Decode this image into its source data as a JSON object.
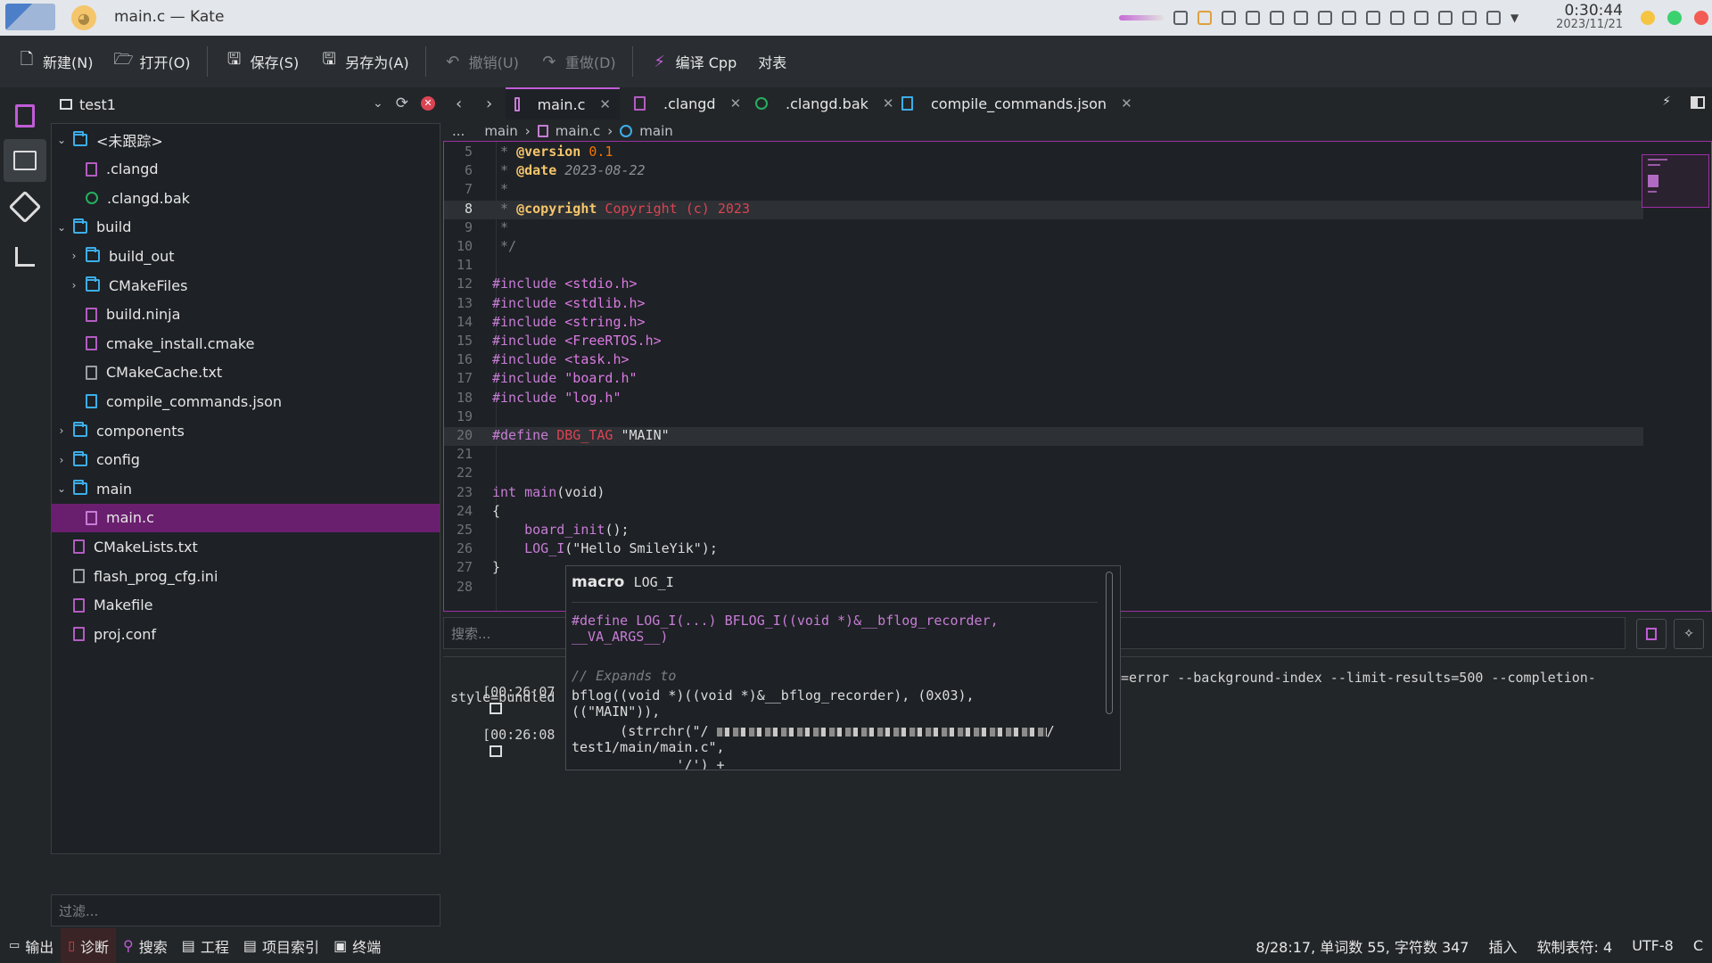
{
  "window": {
    "title": "main.c — Kate"
  },
  "clock": {
    "time": "0:30:44",
    "date": "2023/11/21"
  },
  "colors": {
    "accent": "#c05cd6",
    "selection": "#6a1f6e",
    "editor_bg": "#1e2125",
    "panel_bg": "#232629"
  },
  "toolbar": {
    "new": "新建(N)",
    "open": "打开(O)",
    "save": "保存(S)",
    "save_as": "另存为(A)",
    "undo": "撤销(U)",
    "redo": "重做(D)",
    "compile": "编译 Cpp",
    "pair": "对表"
  },
  "project": {
    "name": "test1",
    "filter_placeholder": "过滤..."
  },
  "tree": [
    {
      "label": "<未跟踪>",
      "kind": "folder",
      "depth": 0,
      "expanded": true
    },
    {
      "label": ".clangd",
      "kind": "file",
      "depth": 1
    },
    {
      "label": ".clangd.bak",
      "kind": "recycle",
      "depth": 1
    },
    {
      "label": "build",
      "kind": "folder",
      "depth": 0,
      "expanded": true
    },
    {
      "label": "build_out",
      "kind": "folder",
      "depth": 1,
      "expanded": false
    },
    {
      "label": "CMakeFiles",
      "kind": "folder",
      "depth": 1,
      "expanded": false
    },
    {
      "label": "build.ninja",
      "kind": "file",
      "depth": 1
    },
    {
      "label": "cmake_install.cmake",
      "kind": "file",
      "depth": 1
    },
    {
      "label": "CMakeCache.txt",
      "kind": "plain",
      "depth": 1
    },
    {
      "label": "compile_commands.json",
      "kind": "json",
      "depth": 1
    },
    {
      "label": "components",
      "kind": "folder",
      "depth": 0,
      "expanded": false
    },
    {
      "label": "config",
      "kind": "folder",
      "depth": 0,
      "expanded": false
    },
    {
      "label": "main",
      "kind": "folder",
      "depth": 0,
      "expanded": true
    },
    {
      "label": "main.c",
      "kind": "c",
      "depth": 1,
      "selected": true
    },
    {
      "label": "CMakeLists.txt",
      "kind": "file",
      "depth": 0
    },
    {
      "label": "flash_prog_cfg.ini",
      "kind": "plain",
      "depth": 0
    },
    {
      "label": "Makefile",
      "kind": "file",
      "depth": 0
    },
    {
      "label": "proj.conf",
      "kind": "file",
      "depth": 0
    }
  ],
  "tabs": [
    {
      "label": "main.c",
      "active": true
    },
    {
      "label": ".clangd"
    },
    {
      "label": ".clangd.bak"
    },
    {
      "label": "compile_commands.json"
    }
  ],
  "breadcrumb": {
    "root": "...",
    "folder": "main",
    "file": "main.c",
    "symbol": "main"
  },
  "code": [
    {
      "n": "5",
      "segs": [
        [
          "c-comment",
          " * "
        ],
        [
          "c-tag",
          "@version"
        ],
        [
          "c-num",
          " 0.1"
        ]
      ]
    },
    {
      "n": "6",
      "segs": [
        [
          "c-comment",
          " * "
        ],
        [
          "c-tag",
          "@date"
        ],
        [
          "c-date",
          " 2023-08-22"
        ]
      ]
    },
    {
      "n": "7",
      "segs": [
        [
          "c-comment",
          " *"
        ]
      ]
    },
    {
      "n": "8",
      "segs": [
        [
          "c-comment",
          " * "
        ],
        [
          "c-tag",
          "@copyright"
        ],
        [
          "c-red",
          " Copyright (c) 2023"
        ]
      ],
      "current": true
    },
    {
      "n": "9",
      "segs": [
        [
          "c-comment",
          " *"
        ]
      ]
    },
    {
      "n": "10",
      "segs": [
        [
          "c-comment",
          " */"
        ]
      ]
    },
    {
      "n": "11",
      "segs": []
    },
    {
      "n": "12",
      "segs": [
        [
          "c-pre",
          "#include "
        ],
        [
          "c-inc",
          "<stdio.h>"
        ]
      ]
    },
    {
      "n": "13",
      "segs": [
        [
          "c-pre",
          "#include "
        ],
        [
          "c-inc",
          "<stdlib.h>"
        ]
      ]
    },
    {
      "n": "14",
      "segs": [
        [
          "c-pre",
          "#include "
        ],
        [
          "c-inc",
          "<string.h>"
        ]
      ]
    },
    {
      "n": "15",
      "segs": [
        [
          "c-pre",
          "#include "
        ],
        [
          "c-inc",
          "<FreeRTOS.h>"
        ]
      ]
    },
    {
      "n": "16",
      "segs": [
        [
          "c-pre",
          "#include "
        ],
        [
          "c-inc",
          "<task.h>"
        ]
      ]
    },
    {
      "n": "17",
      "segs": [
        [
          "c-pre",
          "#include "
        ],
        [
          "c-inc",
          "\"board.h\""
        ]
      ]
    },
    {
      "n": "18",
      "segs": [
        [
          "c-pre",
          "#include "
        ],
        [
          "c-inc",
          "\"log.h\""
        ]
      ]
    },
    {
      "n": "19",
      "segs": []
    },
    {
      "n": "20",
      "segs": [
        [
          "c-pre",
          "#define "
        ],
        [
          "c-red",
          "DBG_TAG"
        ],
        [
          "c-str",
          " \"MAIN\""
        ]
      ],
      "hl": true
    },
    {
      "n": "21",
      "segs": []
    },
    {
      "n": "22",
      "segs": []
    },
    {
      "n": "23",
      "segs": [
        [
          "c-kw",
          "int "
        ],
        [
          "c-call",
          "main"
        ],
        [
          "c-str",
          "(void)"
        ]
      ]
    },
    {
      "n": "24",
      "segs": [
        [
          "c-str",
          "{"
        ]
      ]
    },
    {
      "n": "25",
      "segs": [
        [
          "c-call",
          "    board_init"
        ],
        [
          "c-str",
          "();"
        ]
      ]
    },
    {
      "n": "26",
      "segs": [
        [
          "c-call",
          "    LOG_I"
        ],
        [
          "c-str",
          "(\"Hello SmileYik\");"
        ]
      ]
    },
    {
      "n": "27",
      "segs": [
        [
          "c-str",
          "}"
        ]
      ]
    },
    {
      "n": "28",
      "segs": []
    }
  ],
  "search": {
    "placeholder": "搜索..."
  },
  "output": {
    "line1_time": "[00:26:07",
    "line1_tail": "=error --background-index --limit-results=500 --completion-",
    "line2": "style=bundled",
    "line3_time": "[00:26:08"
  },
  "popup": {
    "kind": "macro",
    "name": "LOG_I",
    "def1": "#define LOG_I(...) BFLOG_I((void *)&__bflog_recorder,",
    "def2": "__VA_ARGS__)",
    "exp_comment": "// Expands to",
    "exp1": "bflog((void *)((void *)&__bflog_recorder), (0x03),",
    "exp2": "((\"MAIN\")),",
    "exp3a": "      (strrchr(\"/",
    "exp3b": "/",
    "exp4": "test1/main/main.c\",",
    "exp5": "             '/') +"
  },
  "statusbar": {
    "output": "输出",
    "diagnostics": "诊断",
    "search": "搜索",
    "project": "工程",
    "index": "项目索引",
    "terminal": "终端",
    "position": "8/28:17, 单词数 55, 字符数 347",
    "mode": "插入",
    "indent": "软制表符: 4",
    "encoding": "UTF-8",
    "extra": "C"
  }
}
